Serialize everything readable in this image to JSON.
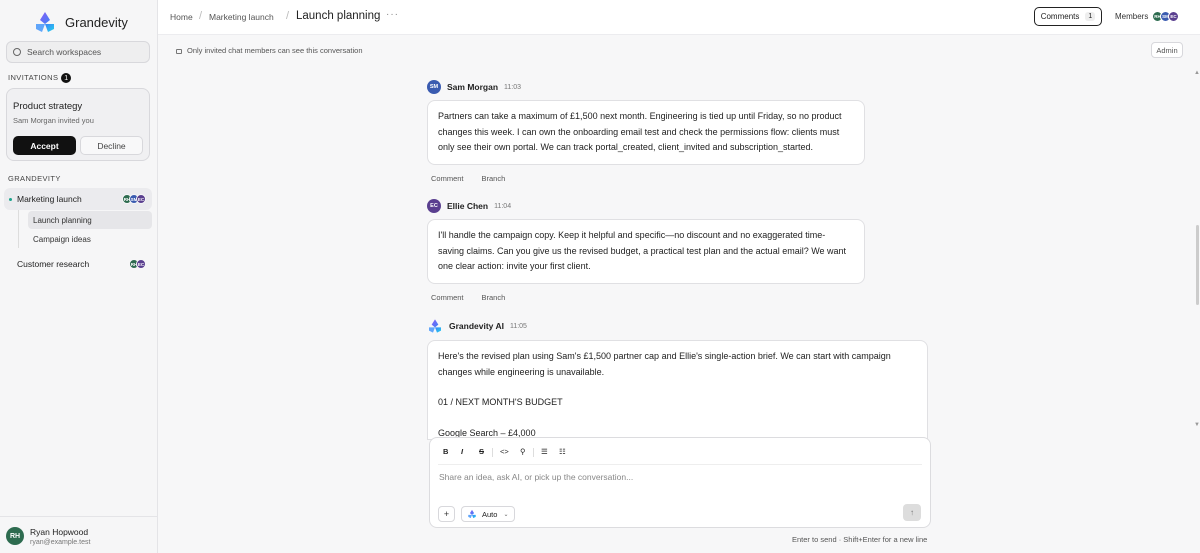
{
  "app": {
    "name": "Grandevity"
  },
  "sidebar": {
    "search_placeholder": "Search workspaces",
    "invitations_label": "INVITATIONS",
    "invitations_count": "1",
    "invitation": {
      "title": "Product strategy",
      "subtitle": "Sam Morgan invited you",
      "accept_label": "Accept",
      "decline_label": "Decline"
    },
    "section_label": "GRANDEVITY",
    "workspaces": [
      {
        "label": "Marketing launch",
        "avatars": [
          "RH",
          "SM",
          "EC"
        ]
      },
      {
        "label": "Customer research",
        "avatars": [
          "RH",
          "EC"
        ]
      }
    ],
    "sub_items": [
      {
        "label": "Launch planning"
      },
      {
        "label": "Campaign ideas"
      }
    ],
    "user": {
      "initials": "RH",
      "name": "Ryan Hopwood",
      "email": "ryan@example.test"
    }
  },
  "header": {
    "breadcrumb": [
      "Home",
      "Marketing launch"
    ],
    "current": "Launch planning",
    "more": "···",
    "comments_label": "Comments",
    "comments_count": "1",
    "members_label": "Members",
    "members": [
      "RH",
      "SM",
      "EC"
    ]
  },
  "notice": {
    "text": "Only invited chat members can see this conversation",
    "admin_label": "Admin"
  },
  "messages": [
    {
      "initials": "SM",
      "author": "Sam Morgan",
      "time": "11:03",
      "lines": [
        "Partners can take a maximum of £1,500 next month. Engineering is tied up until Friday, so no product",
        "changes this week. I can own the onboarding email test and check the permissions flow: clients must",
        "only see their own portal. We can track portal_created, client_invited and subscription_started."
      ],
      "comment_label": "Comment",
      "branch_label": "Branch"
    },
    {
      "initials": "EC",
      "author": "Ellie Chen",
      "time": "11:04",
      "lines": [
        "I'll handle the campaign copy. Keep it helpful and specific—no discount and no exaggerated time-",
        "saving claims. Can you give us the revised budget, a practical test plan and the actual email? We want",
        "one clear action: invite your first client."
      ],
      "comment_label": "Comment",
      "branch_label": "Branch"
    },
    {
      "author": "Grandevity AI",
      "time": "11:05",
      "lines": [
        "Here's the revised plan using Sam's £1,500 partner cap and Ellie's single-action brief. We can start with campaign",
        "changes while engineering is unavailable."
      ],
      "section": "01 / NEXT MONTH'S BUDGET",
      "partial": "Google Search – £4,000"
    }
  ],
  "composer": {
    "toolbar": [
      "B",
      "I",
      "S",
      "<>",
      "⚲",
      "☰",
      "☷"
    ],
    "placeholder": "Share an idea, ask AI, or pick up the conversation...",
    "plus": "+",
    "model_label": "Auto",
    "send": "↑",
    "hint": "Enter to send · Shift+Enter for a new line"
  },
  "colors": {
    "accent": "#1aa38c",
    "sm": "#3a5bb0",
    "ec": "#5a3f8f",
    "rh": "#2d6b4f"
  }
}
